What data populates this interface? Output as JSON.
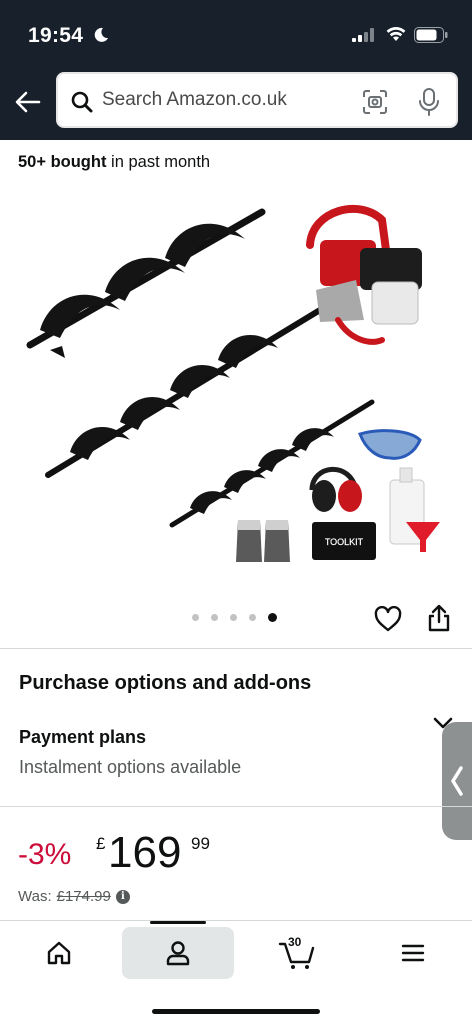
{
  "status_bar": {
    "time": "19:54"
  },
  "search": {
    "placeholder": "Search Amazon.co.uk"
  },
  "social_proof": {
    "count": "50+ bought",
    "suffix": " in past month"
  },
  "gallery": {
    "image_count": 5,
    "active_index": 4,
    "toolkit_label": "TOOLKIT"
  },
  "purchase_options": {
    "title": "Purchase options and add-ons",
    "payment_title": "Payment plans",
    "payment_sub": "Instalment options available"
  },
  "price": {
    "discount": "-3%",
    "currency": "£",
    "whole": "169",
    "fraction": "99",
    "was_label": "Was:",
    "was_price": "£174.99"
  },
  "tab_bar": {
    "cart_count": "30"
  },
  "colors": {
    "header_bg": "#17202b",
    "discount_red": "#cc0c39",
    "text": "#0f1111"
  }
}
